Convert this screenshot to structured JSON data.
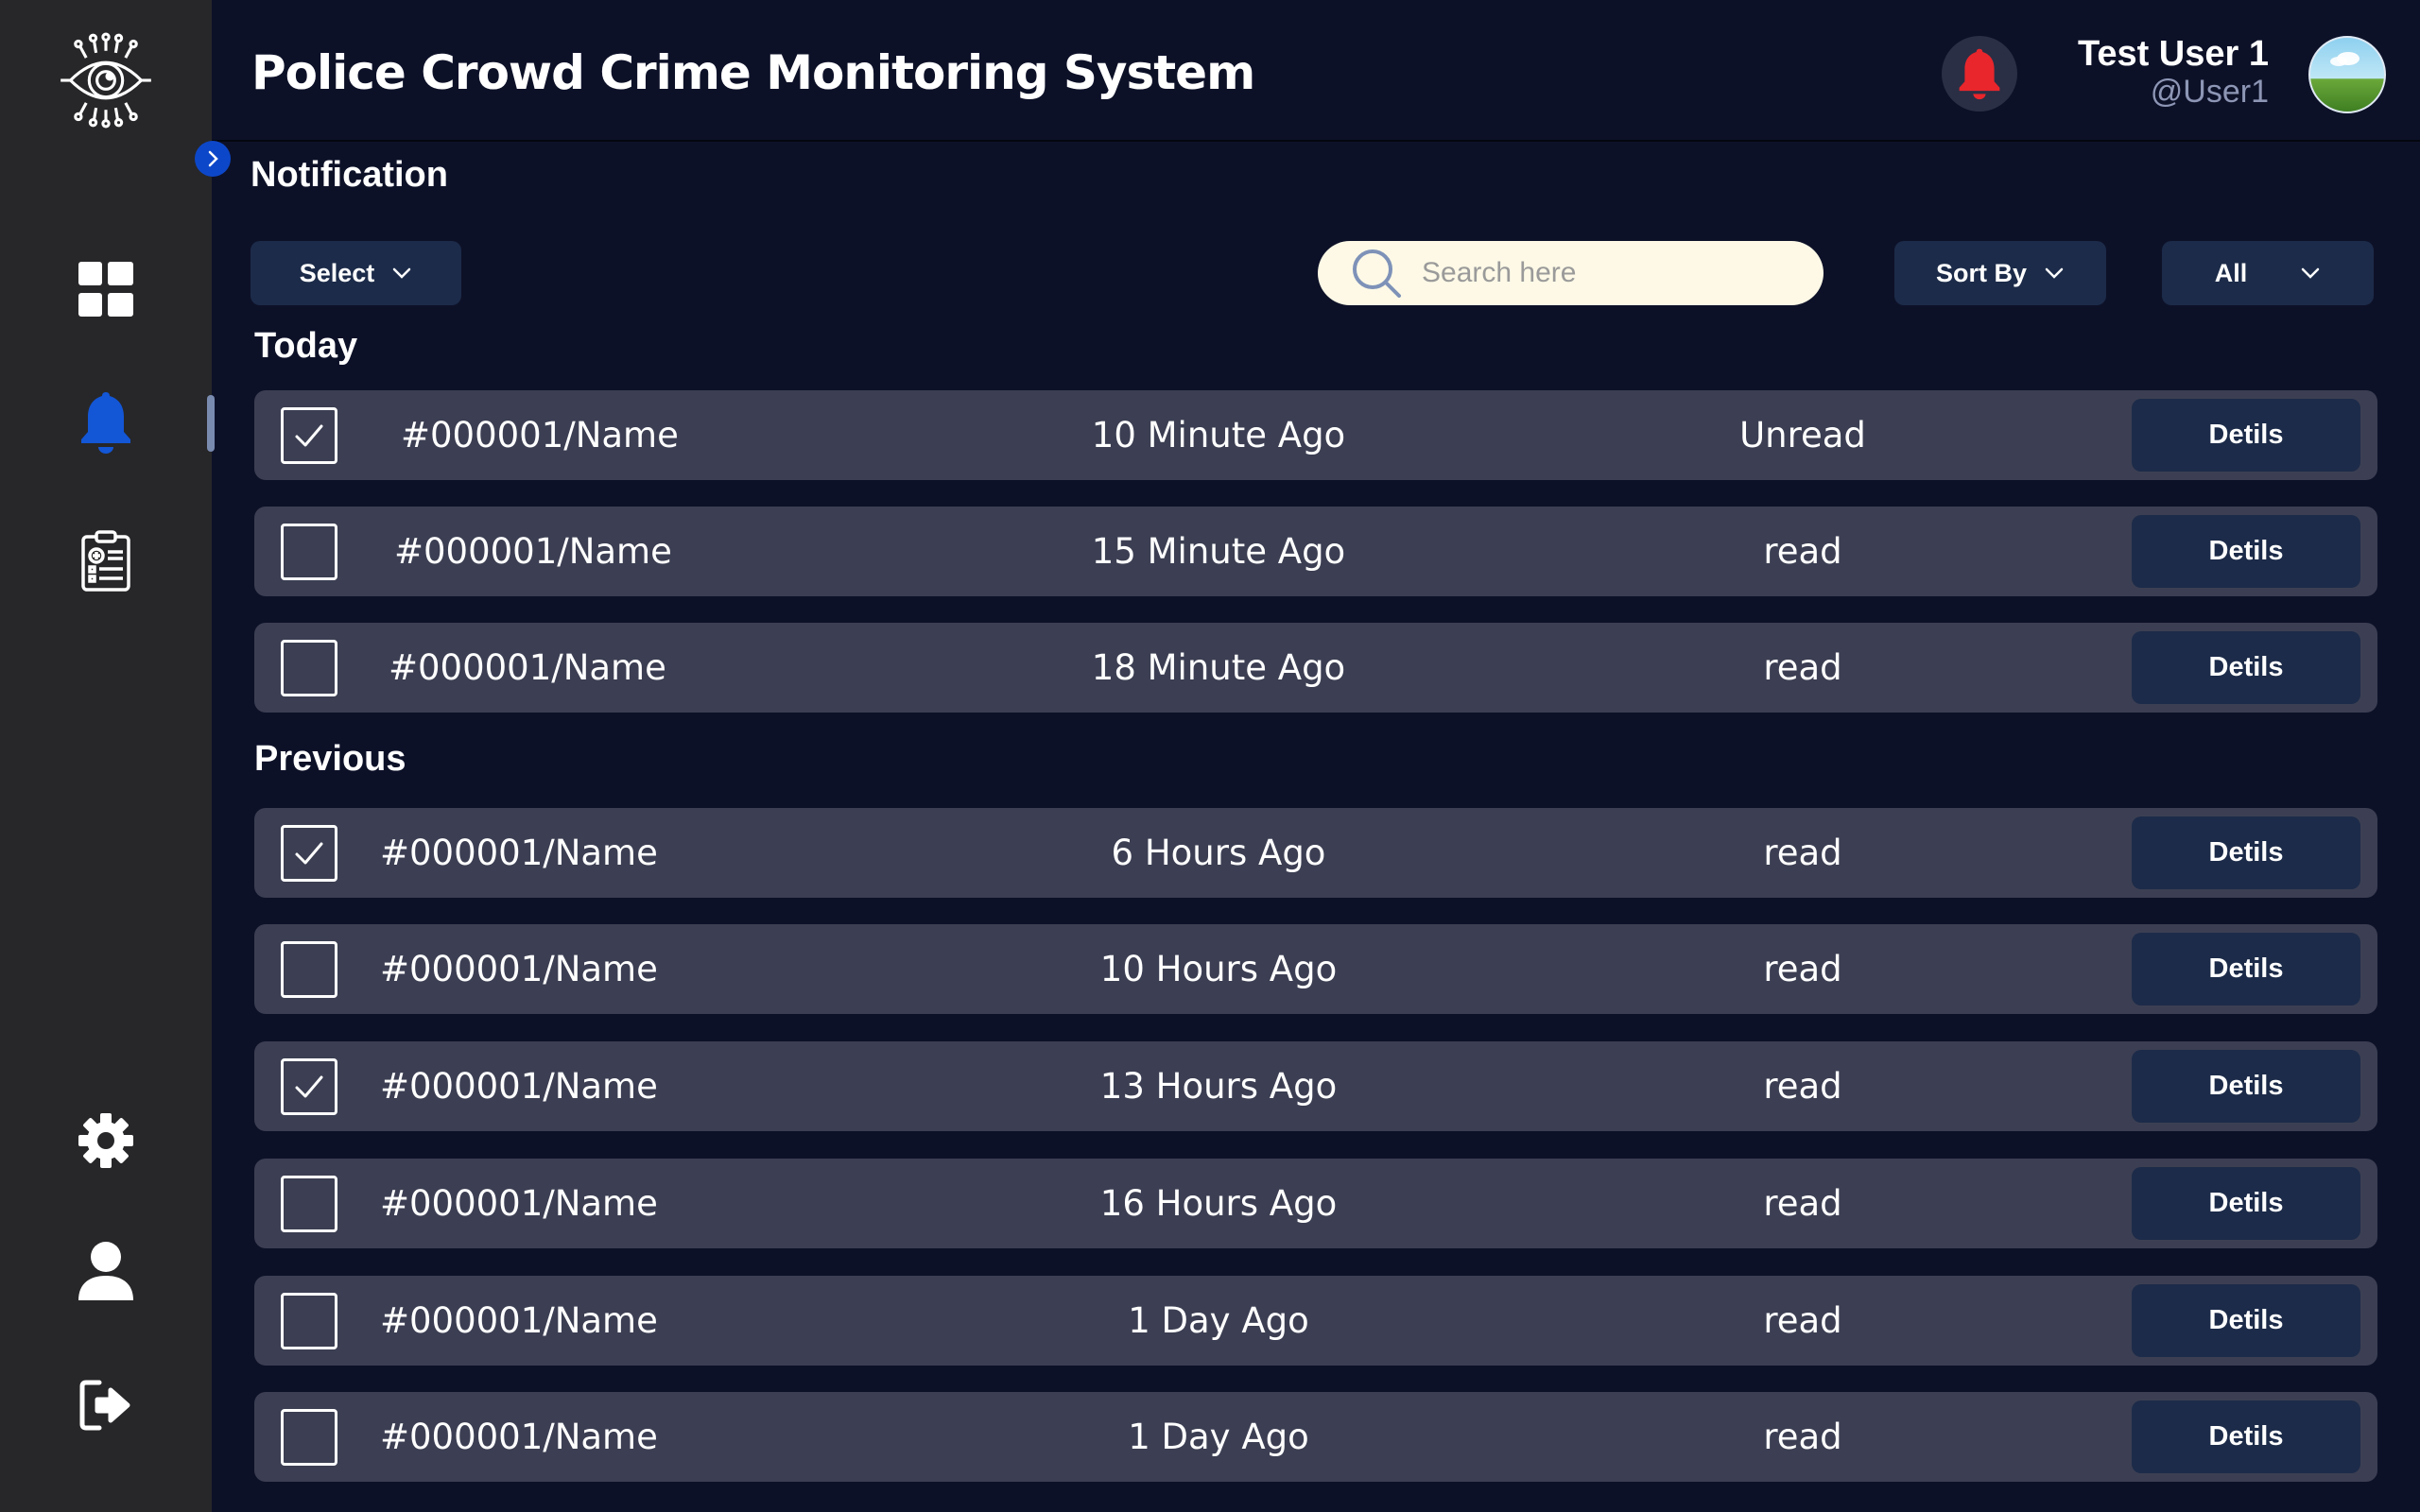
{
  "header": {
    "title": "Police Crowd Crime Monitoring System",
    "user_name": "Test User 1",
    "user_handle": "@User1"
  },
  "sidebar": {
    "items": [
      {
        "name": "dashboard",
        "icon": "dashboard-grid-icon"
      },
      {
        "name": "notifications",
        "icon": "bell-icon",
        "active": true
      },
      {
        "name": "reports",
        "icon": "clipboard-report-icon"
      },
      {
        "name": "settings",
        "icon": "gear-icon"
      },
      {
        "name": "profile",
        "icon": "user-icon"
      },
      {
        "name": "logout",
        "icon": "logout-icon"
      }
    ]
  },
  "page": {
    "title": "Notification",
    "select_label": "Select",
    "search_placeholder": "Search here",
    "sort_label": "Sort By",
    "filter_label": "All"
  },
  "sections": {
    "today": "Today",
    "previous": "Previous"
  },
  "notifications_today": [
    {
      "name": "#000001/Name",
      "time": "10 Minute Ago",
      "status": "Unread",
      "checked": true,
      "action": "Detils"
    },
    {
      "name": "#000001/Name",
      "time": "15 Minute Ago",
      "status": "read",
      "checked": false,
      "action": "Detils"
    },
    {
      "name": "#000001/Name",
      "time": "18 Minute Ago",
      "status": "read",
      "checked": false,
      "action": "Detils"
    }
  ],
  "notifications_previous": [
    {
      "name": "#000001/Name",
      "time": "6 Hours Ago",
      "status": "read",
      "checked": true,
      "action": "Detils"
    },
    {
      "name": "#000001/Name",
      "time": "10 Hours Ago",
      "status": "read",
      "checked": false,
      "action": "Detils"
    },
    {
      "name": "#000001/Name",
      "time": "13 Hours Ago",
      "status": "read",
      "checked": true,
      "action": "Detils"
    },
    {
      "name": "#000001/Name",
      "time": "16 Hours Ago",
      "status": "read",
      "checked": false,
      "action": "Detils"
    },
    {
      "name": "#000001/Name",
      "time": "1 Day Ago",
      "status": "read",
      "checked": false,
      "action": "Detils"
    },
    {
      "name": "#000001/Name",
      "time": "1 Day Ago",
      "status": "read",
      "checked": false,
      "action": "Detils"
    }
  ],
  "colors": {
    "background": "#0d1128",
    "sidebar": "#272729",
    "row": "#3c3f53",
    "button": "#1c2b49",
    "accent": "#0d47c9",
    "alert": "#e8262c"
  }
}
